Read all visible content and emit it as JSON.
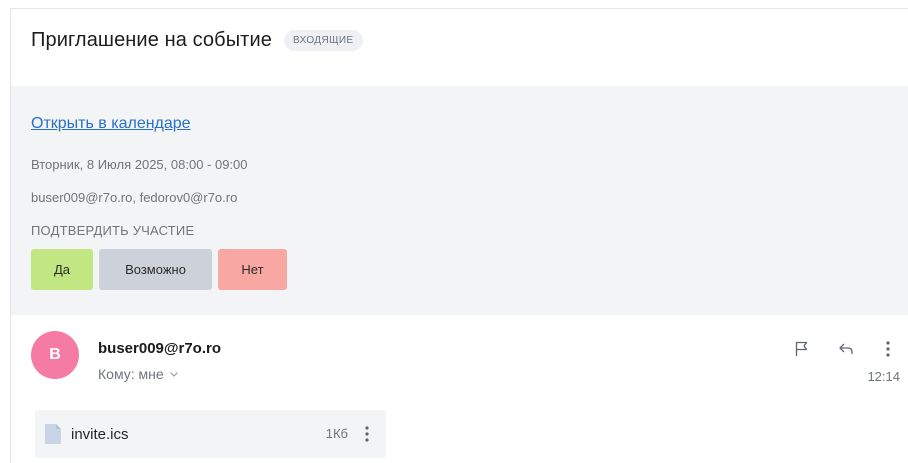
{
  "message": {
    "subject": "Приглашение на событие",
    "folder_badge": "ВХОДЯЩИЕ"
  },
  "invitation": {
    "open_calendar_label": "Открыть в календаре",
    "date_time": "Вторник, 8 Июля 2025, 08:00 - 09:00",
    "participants": "buser009@r7o.ro, fedorov0@r7o.ro",
    "rsvp_heading": "ПОДТВЕРДИТЬ УЧАСТИЕ",
    "rsvp_buttons": {
      "yes": "Да",
      "maybe": "Возможно",
      "no": "Нет"
    }
  },
  "sender": {
    "avatar_letter": "B",
    "email": "buser009@r7o.ro",
    "recipient_label": "Кому: мне",
    "time": "12:14",
    "icons": [
      "flag-icon",
      "reply-icon",
      "more-vertical-icon",
      "chevron-down-icon"
    ]
  },
  "attachment": {
    "file_name": "invite.ics",
    "size": "1Кб",
    "icon": "file-icon"
  },
  "colors": {
    "link": "#2a6fc9",
    "panel_bg": "#f2f4f6",
    "yes_bg": "#c2e681",
    "maybe_bg": "#cdd2da",
    "no_bg": "#f9a7a3",
    "avatar_bg": "#f57aa4"
  }
}
